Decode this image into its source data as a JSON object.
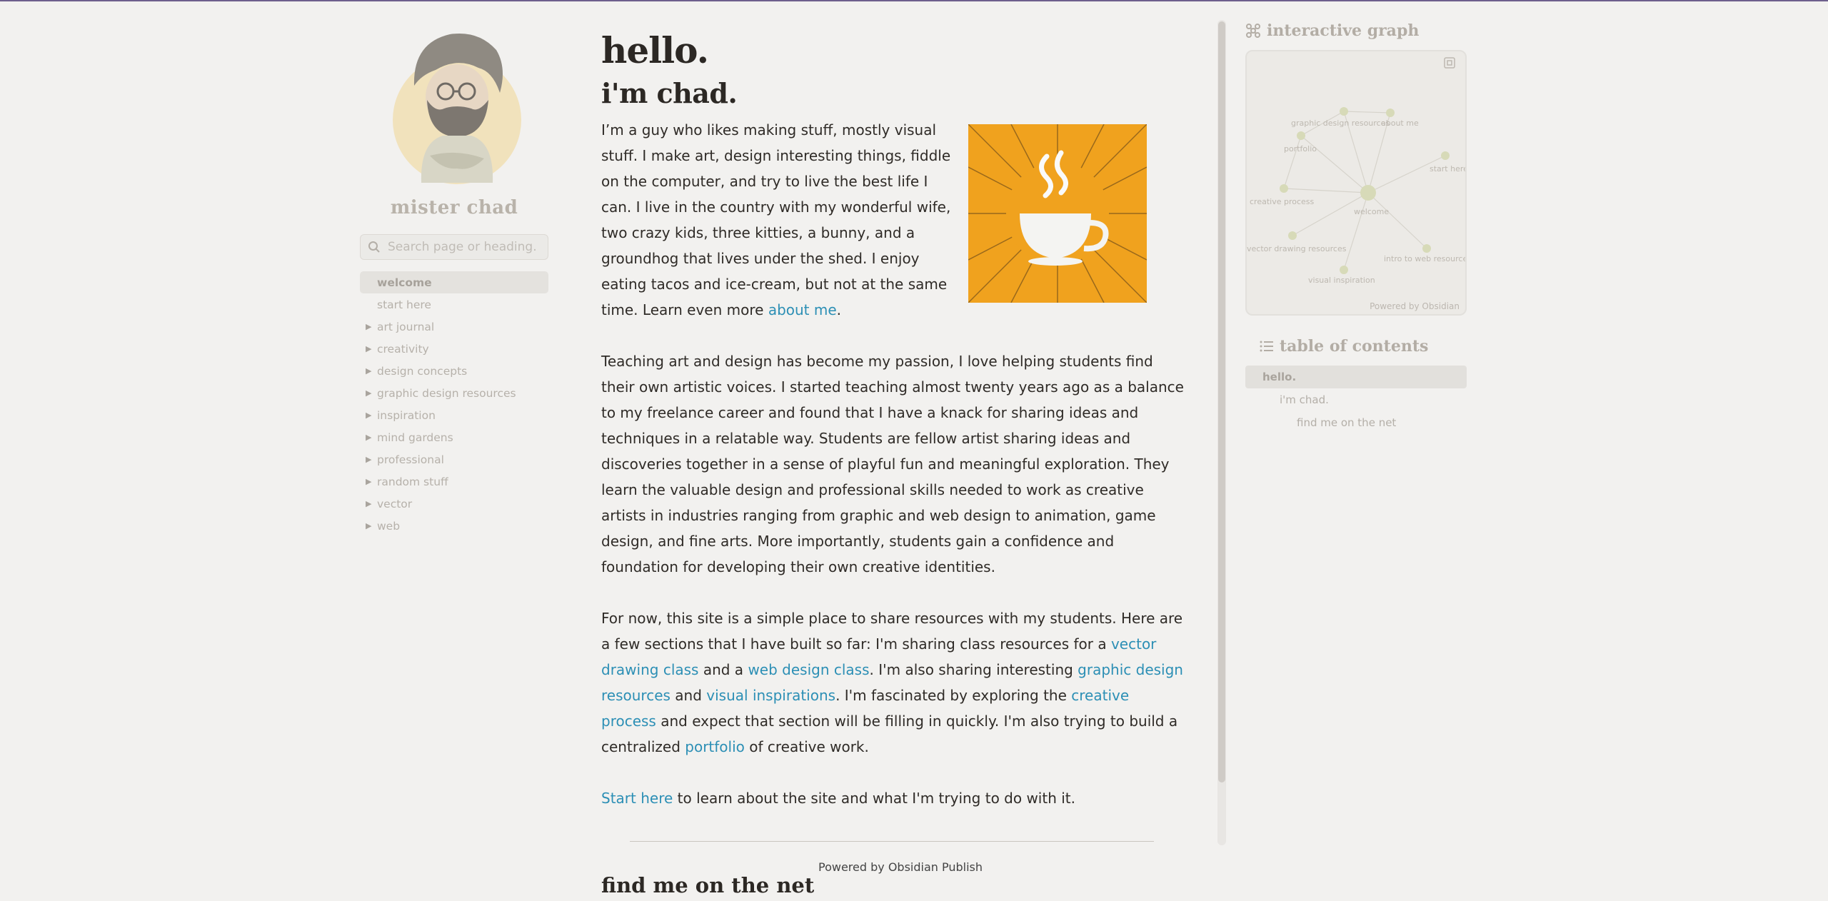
{
  "sidebar": {
    "site_name": "mister chad",
    "search_placeholder": "Search page or heading...",
    "items": [
      {
        "label": "welcome",
        "active": true,
        "folder": false
      },
      {
        "label": "start here",
        "active": false,
        "folder": false
      },
      {
        "label": "art journal",
        "folder": true
      },
      {
        "label": "creativity",
        "folder": true
      },
      {
        "label": "design concepts",
        "folder": true
      },
      {
        "label": "graphic design resources",
        "folder": true
      },
      {
        "label": "inspiration",
        "folder": true
      },
      {
        "label": "mind gardens",
        "folder": true
      },
      {
        "label": "professional",
        "folder": true
      },
      {
        "label": "random stuff",
        "folder": true
      },
      {
        "label": "vector",
        "folder": true
      },
      {
        "label": "web",
        "folder": true
      }
    ],
    "folder_glyph": "▶"
  },
  "main": {
    "title": "hello.",
    "subtitle": "i'm chad.",
    "intro_text": "I’m a guy who likes making stuff, mostly visual stuff. I make art, design interesting things, fiddle on the computer, and try to live the best life I can. I live in the country with my wonderful wife, two crazy kids, three kitties, a bunny, and a groundhog that lives under the shed. I enjoy eating tacos and ice-cream, but not at the same time. Learn even more ",
    "intro_link": "about me",
    "intro_end": ".",
    "teaching_text": "Teaching art and design has become my passion, I love helping students find their own artistic voices. I started teaching almost twenty years ago as a balance to my freelance career and found that I have a knack for sharing ideas and techniques in a relatable way. Students are fellow artist sharing ideas and discoveries together in a sense of playful fun and meaningful exploration. They learn the valuable design and professional skills needed to work as creative artists in industries ranging from graphic and web design to animation, game design, and fine arts. More importantly, students gain a confidence and foundation for developing their own creative identities.",
    "site_para": {
      "t1": "For now, this site is a simple place to share resources with my students. Here are a few sections that I have built so far: I'm sharing class resources for a ",
      "l1": "vector drawing class",
      "t2": " and a ",
      "l2": "web design class",
      "t3": ". I'm also sharing interesting ",
      "l3": "graphic design resources",
      "t4": " and ",
      "l4": "visual inspirations",
      "t5": ". I'm fascinated by exploring the ",
      "l5": "creative process",
      "t6": " and expect that section will be filling in quickly. I'm also trying to build a centralized ",
      "l6": "portfolio",
      "t7": " of creative work."
    },
    "start_link": "Start here",
    "start_text": " to learn about the site and what I'm trying to do with it.",
    "net_heading": "find me on the net",
    "coffee_image": "coffee-cup-illustration"
  },
  "footer": "Powered by Obsidian Publish",
  "graph": {
    "title": "interactive graph",
    "powered": "Powered by Obsidian",
    "nodes": [
      {
        "label": "welcome"
      },
      {
        "label": "graphic design resources"
      },
      {
        "label": "about me"
      },
      {
        "label": "portfolio"
      },
      {
        "label": "start here"
      },
      {
        "label": "creative process"
      },
      {
        "label": "vector drawing resources"
      },
      {
        "label": "intro to web resources"
      },
      {
        "label": "visual inspiration"
      }
    ]
  },
  "toc": {
    "title": "table of contents",
    "items": [
      {
        "label": "hello.",
        "level": 1,
        "active": true
      },
      {
        "label": "i'm chad.",
        "level": 2
      },
      {
        "label": "find me on the net",
        "level": 3
      }
    ]
  },
  "colors": {
    "accent_link": "#2c8fb5",
    "coffee_bg": "#f0a21e",
    "background": "#f2f1ef"
  }
}
